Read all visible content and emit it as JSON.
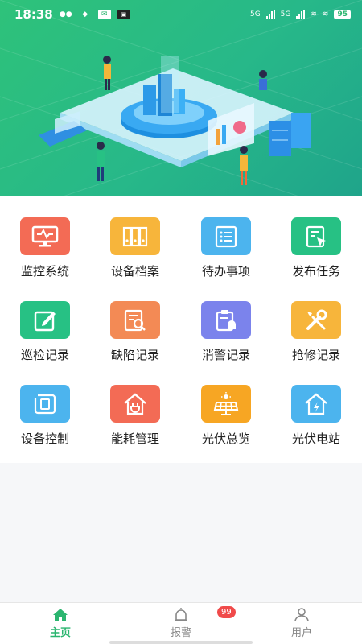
{
  "status_bar": {
    "time": "18:38",
    "network_1": "5G",
    "network_2": "5G",
    "battery": "95"
  },
  "banner": {
    "image": "isometric-smart-monitoring-illustration"
  },
  "menu": {
    "items": [
      {
        "label": "监控系统",
        "icon": "monitor-icon",
        "color": "#f36b55"
      },
      {
        "label": "设备档案",
        "icon": "archive-icon",
        "color": "#f7b53b"
      },
      {
        "label": "待办事项",
        "icon": "todo-list-icon",
        "color": "#4cb4ee"
      },
      {
        "label": "发布任务",
        "icon": "publish-task-icon",
        "color": "#27c184"
      },
      {
        "label": "巡检记录",
        "icon": "inspect-edit-icon",
        "color": "#27c184"
      },
      {
        "label": "缺陷记录",
        "icon": "defect-search-icon",
        "color": "#f38a55"
      },
      {
        "label": "消警记录",
        "icon": "alarm-clear-icon",
        "color": "#7b83ec"
      },
      {
        "label": "抢修记录",
        "icon": "repair-tools-icon",
        "color": "#f7b53b"
      },
      {
        "label": "设备控制",
        "icon": "device-control-icon",
        "color": "#4cb4ee"
      },
      {
        "label": "能耗管理",
        "icon": "energy-house-icon",
        "color": "#f36b55"
      },
      {
        "label": "光伏总览",
        "icon": "solar-panel-icon",
        "color": "#f7a623"
      },
      {
        "label": "光伏电站",
        "icon": "solar-station-icon",
        "color": "#4cb4ee"
      }
    ]
  },
  "tabbar": {
    "tabs": [
      {
        "label": "主页",
        "icon": "home-icon"
      },
      {
        "label": "报警",
        "icon": "alarm-bell-icon",
        "badge": "99"
      },
      {
        "label": "用户",
        "icon": "user-icon"
      }
    ],
    "active_color": "#2bb56f"
  }
}
